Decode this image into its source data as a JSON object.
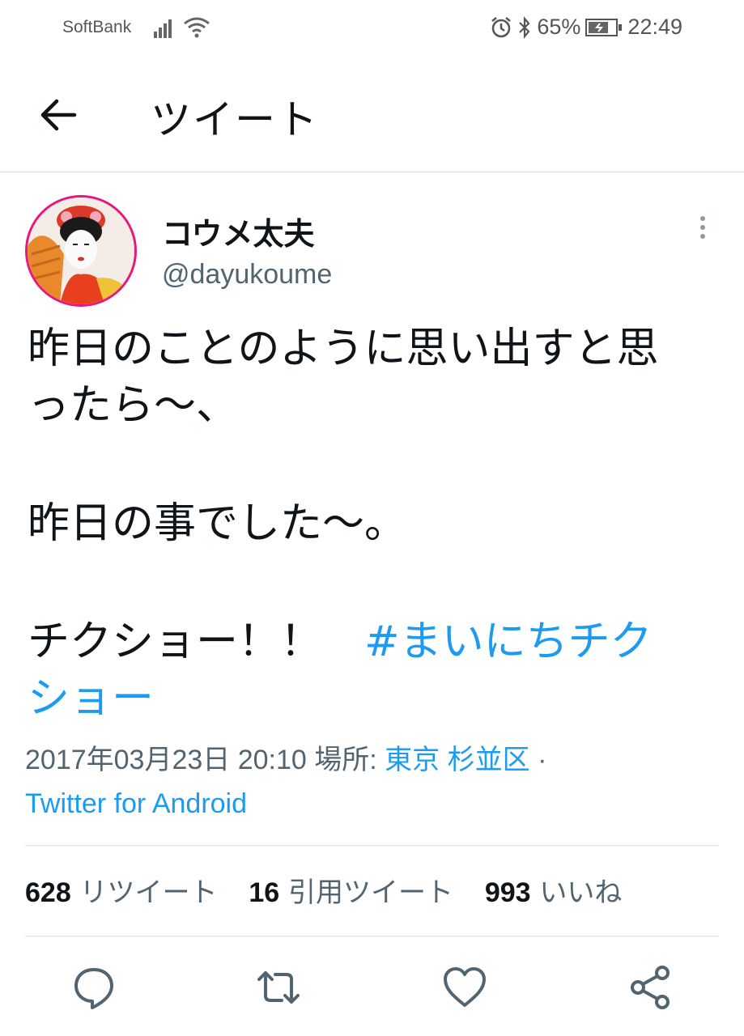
{
  "status_bar": {
    "carrier": "SoftBank",
    "battery": "65%",
    "time": "22:49"
  },
  "header": {
    "title": "ツイート"
  },
  "tweet": {
    "display_name": "コウメ太夫",
    "handle": "@dayukoume",
    "lines": [
      "昨日のことのように思い出すと思",
      "ったら〜、",
      "昨日の事でした〜。",
      "チクショー！！　"
    ],
    "hashtag_part1": "#まいにちチク",
    "hashtag_part2": "ショー",
    "timestamp": "2017年03月23日 20:10",
    "location_label": "場所:",
    "location": "東京 杉並区",
    "separator": "·",
    "source": "Twitter for Android"
  },
  "stats": {
    "retweets_count": "628",
    "retweets_label": "リツイート",
    "quotes_count": "16",
    "quotes_label": "引用ツイート",
    "likes_count": "993",
    "likes_label": "いいね"
  },
  "colors": {
    "accent": "#1d9bf0",
    "text": "#0f1419",
    "secondary": "#536471"
  },
  "icons": [
    "back-arrow-icon",
    "more-vertical-icon",
    "reply-icon",
    "retweet-icon",
    "like-icon",
    "share-icon",
    "signal-icon",
    "wifi-icon",
    "alarm-icon",
    "bluetooth-icon",
    "battery-icon"
  ]
}
